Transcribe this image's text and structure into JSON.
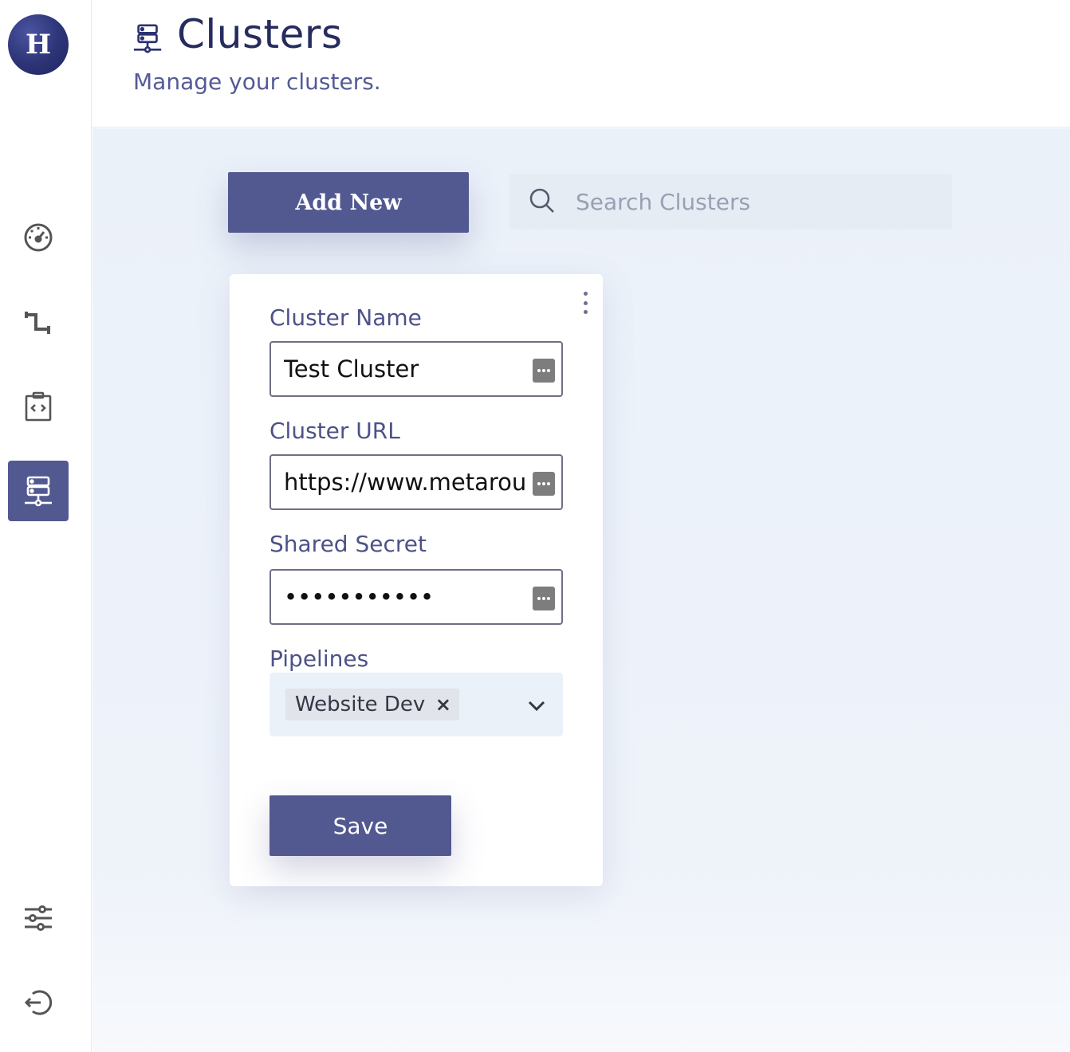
{
  "app": {
    "logo_letter": "H"
  },
  "sidebar": {
    "items": [
      {
        "name": "dashboard",
        "icon": "gauge-icon"
      },
      {
        "name": "pipelines",
        "icon": "pipeline-icon"
      },
      {
        "name": "code",
        "icon": "clipboard-code-icon"
      },
      {
        "name": "clusters",
        "icon": "server-icon",
        "active": true
      },
      {
        "name": "settings",
        "icon": "sliders-icon"
      },
      {
        "name": "logout",
        "icon": "logout-icon"
      }
    ]
  },
  "header": {
    "title": "Clusters",
    "subtitle": "Manage your clusters."
  },
  "toolbar": {
    "add_label": "Add New",
    "search_placeholder": "Search Clusters"
  },
  "card": {
    "fields": {
      "name_label": "Cluster Name",
      "name_value": "Test Cluster",
      "url_label": "Cluster URL",
      "url_value": "https://www.metarouter.io",
      "secret_label": "Shared Secret",
      "secret_value": "•••••••••••",
      "pipelines_label": "Pipelines",
      "pipelines_selected": "Website Dev",
      "tag_remove": "×"
    },
    "save_label": "Save"
  },
  "colors": {
    "accent": "#525890",
    "title": "#262c5e",
    "background": "#ebf1f9"
  }
}
